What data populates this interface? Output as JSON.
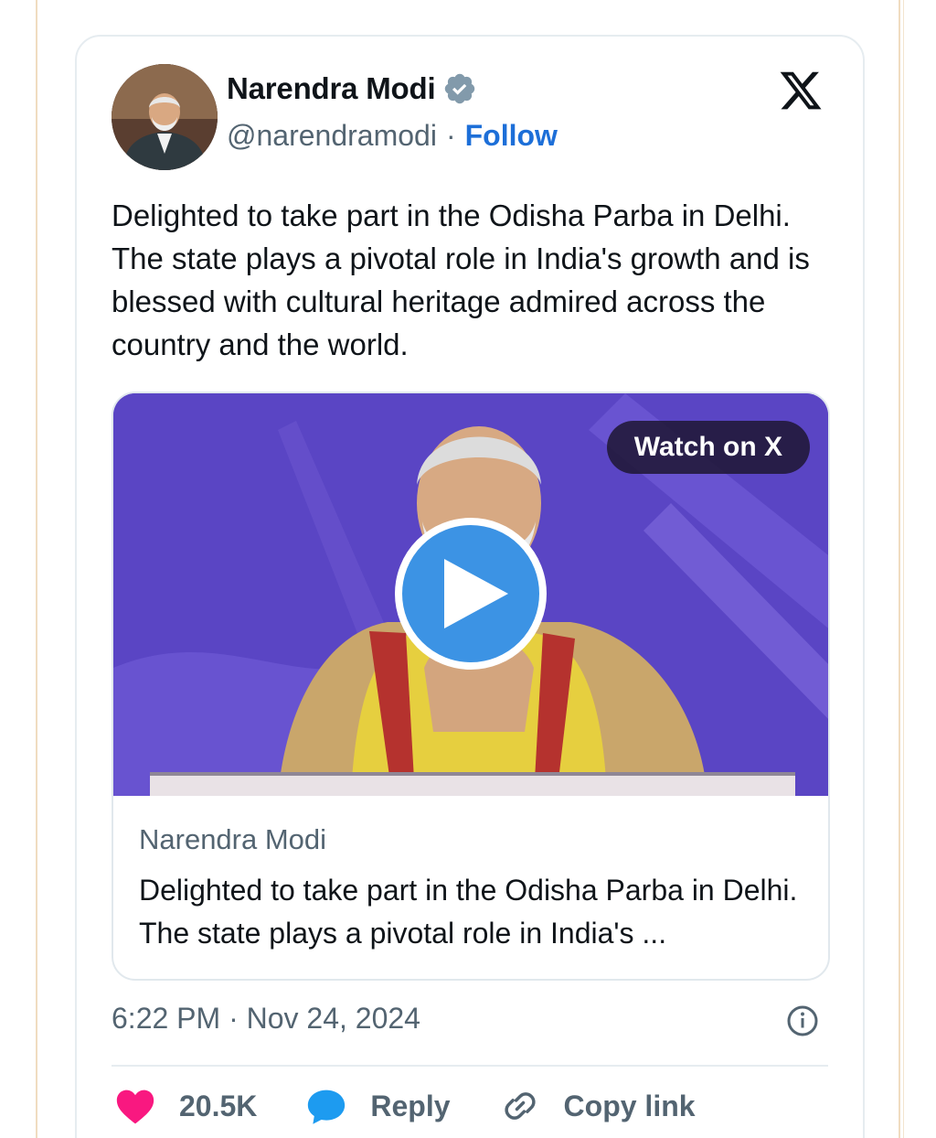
{
  "author": {
    "name": "Narendra Modi",
    "handle": "@narendramodi",
    "separator": "·",
    "follow_label": "Follow"
  },
  "tweet": {
    "text": "Delighted to take part in the Odisha Parba in Delhi. The state plays a pivotal role in India's growth and is blessed with cultural heritage admired across the country and the world."
  },
  "media": {
    "watch_label": "Watch on X",
    "card_name": "Narendra Modi",
    "card_description": "Delighted to take part in the Odisha Parba in Delhi. The state plays a pivotal role in India's ..."
  },
  "meta": {
    "timestamp": "6:22 PM · Nov 24, 2024"
  },
  "actions": {
    "likes": "20.5K",
    "reply_label": "Reply",
    "copy_label": "Copy link"
  },
  "colors": {
    "accent_blue": "#1d6fd8",
    "like_pink": "#f91880",
    "reply_blue": "#1d9bf0",
    "secondary_text": "#536471",
    "video_bg": "#5b47c6",
    "play_button": "#3c93e4"
  },
  "icons": {
    "verified": "verified-badge-icon",
    "x_logo": "x-logo-icon",
    "play": "play-icon",
    "info": "info-icon",
    "heart": "heart-icon",
    "reply": "reply-bubble-icon",
    "link": "link-icon"
  }
}
